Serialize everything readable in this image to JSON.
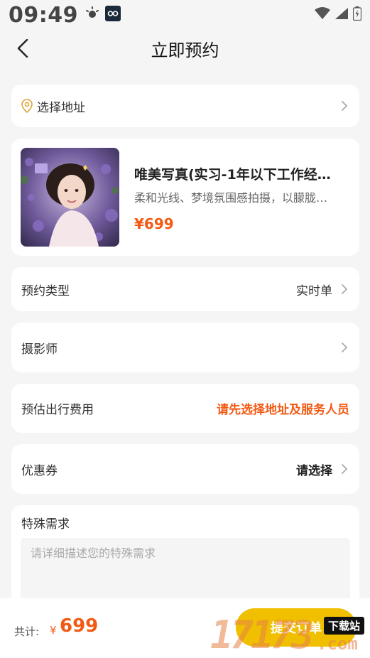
{
  "status": {
    "time": "09:49"
  },
  "nav": {
    "title": "立即预约"
  },
  "address": {
    "label": "选择地址"
  },
  "product": {
    "title": "唯美写真(实习-1年以下工作经…",
    "desc": "柔和光线、梦境氛围感拍摄，以朦胧…",
    "price": "¥699"
  },
  "booking_type": {
    "label": "预约类型",
    "value": "实时单"
  },
  "photographer": {
    "label": "摄影师"
  },
  "travel_fee": {
    "label": "预估出行费用",
    "value": "请先选择地址及服务人员"
  },
  "coupon": {
    "label": "优惠券",
    "value": "请选择"
  },
  "special_needs": {
    "label": "特殊需求",
    "placeholder": "请详细描述您的特殊需求"
  },
  "footer": {
    "total_label": "共计:",
    "currency": "¥",
    "total": "699",
    "submit_label": "提交订单"
  },
  "watermark": {
    "digits": "17173",
    "suffix": ".com",
    "tag": "下载站"
  },
  "colors": {
    "accent": "#f25a14",
    "submit": "#f0c000",
    "background": "#f5f5f5"
  }
}
